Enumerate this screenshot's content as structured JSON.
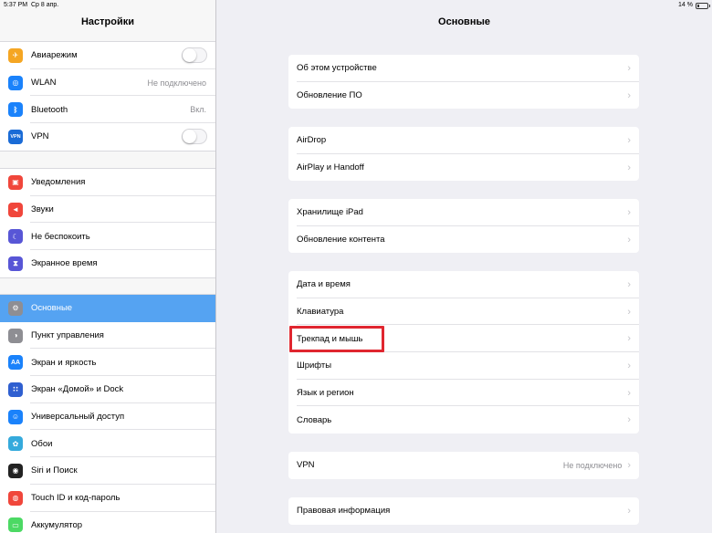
{
  "status_bar": {
    "time": "5:37 PM",
    "date": "Ср 8 апр.",
    "battery": "14 %",
    "battery_level": 0.14
  },
  "sidebar": {
    "title": "Настройки",
    "groups": [
      {
        "items": [
          {
            "label": "Авиарежим",
            "icon": "airplane-icon",
            "color": "#f5a623",
            "control": "toggle",
            "toggle_on": false
          },
          {
            "label": "WLAN",
            "icon": "wifi-icon",
            "color": "#1a82fb",
            "value": "Не подключено"
          },
          {
            "label": "Bluetooth",
            "icon": "bluetooth-icon",
            "color": "#1a82fb",
            "value": "Вкл."
          },
          {
            "label": "VPN",
            "icon": "vpn-icon",
            "color": "#1a6bd6",
            "icon_text": "VPN",
            "control": "toggle",
            "toggle_on": false
          }
        ]
      },
      {
        "items": [
          {
            "label": "Уведомления",
            "icon": "notifications-icon",
            "color": "#f0463b"
          },
          {
            "label": "Звуки",
            "icon": "sounds-icon",
            "color": "#f0463b"
          },
          {
            "label": "Не беспокоить",
            "icon": "moon-icon",
            "color": "#5856d6"
          },
          {
            "label": "Экранное время",
            "icon": "hourglass-icon",
            "color": "#5856d6"
          }
        ]
      },
      {
        "items": [
          {
            "label": "Основные",
            "icon": "gear-icon",
            "color": "#8e8e93",
            "selected": true
          },
          {
            "label": "Пункт управления",
            "icon": "control-center-icon",
            "color": "#8e8e93"
          },
          {
            "label": "Экран и яркость",
            "icon": "display-icon",
            "color": "#1a82fb",
            "icon_text": "AA"
          },
          {
            "label": "Экран «Домой» и Dock",
            "icon": "home-screen-icon",
            "color": "#2f5fd0"
          },
          {
            "label": "Универсальный доступ",
            "icon": "accessibility-icon",
            "color": "#1a82fb"
          },
          {
            "label": "Обои",
            "icon": "wallpaper-icon",
            "color": "#35aadc"
          },
          {
            "label": "Siri и Поиск",
            "icon": "siri-icon",
            "color": "#222"
          },
          {
            "label": "Touch ID и код-пароль",
            "icon": "touch-id-icon",
            "color": "#f0463b"
          },
          {
            "label": "Аккумулятор",
            "icon": "battery-icon",
            "color": "#4cd964"
          }
        ]
      }
    ]
  },
  "main": {
    "title": "Основные",
    "groups": [
      {
        "items": [
          {
            "label": "Об этом устройстве"
          },
          {
            "label": "Обновление ПО"
          }
        ]
      },
      {
        "items": [
          {
            "label": "AirDrop"
          },
          {
            "label": "AirPlay и Handoff"
          }
        ]
      },
      {
        "items": [
          {
            "label": "Хранилище iPad"
          },
          {
            "label": "Обновление контента"
          }
        ]
      },
      {
        "items": [
          {
            "label": "Дата и время"
          },
          {
            "label": "Клавиатура"
          },
          {
            "label": "Трекпад и мышь",
            "highlighted": true
          },
          {
            "label": "Шрифты"
          },
          {
            "label": "Язык и регион"
          },
          {
            "label": "Словарь"
          }
        ]
      },
      {
        "items": [
          {
            "label": "VPN",
            "value": "Не подключено"
          }
        ]
      },
      {
        "items": [
          {
            "label": "Правовая информация"
          }
        ]
      }
    ]
  },
  "colors": {
    "accent_selected": "#55a3f2",
    "highlight_box": "#e0262f"
  }
}
